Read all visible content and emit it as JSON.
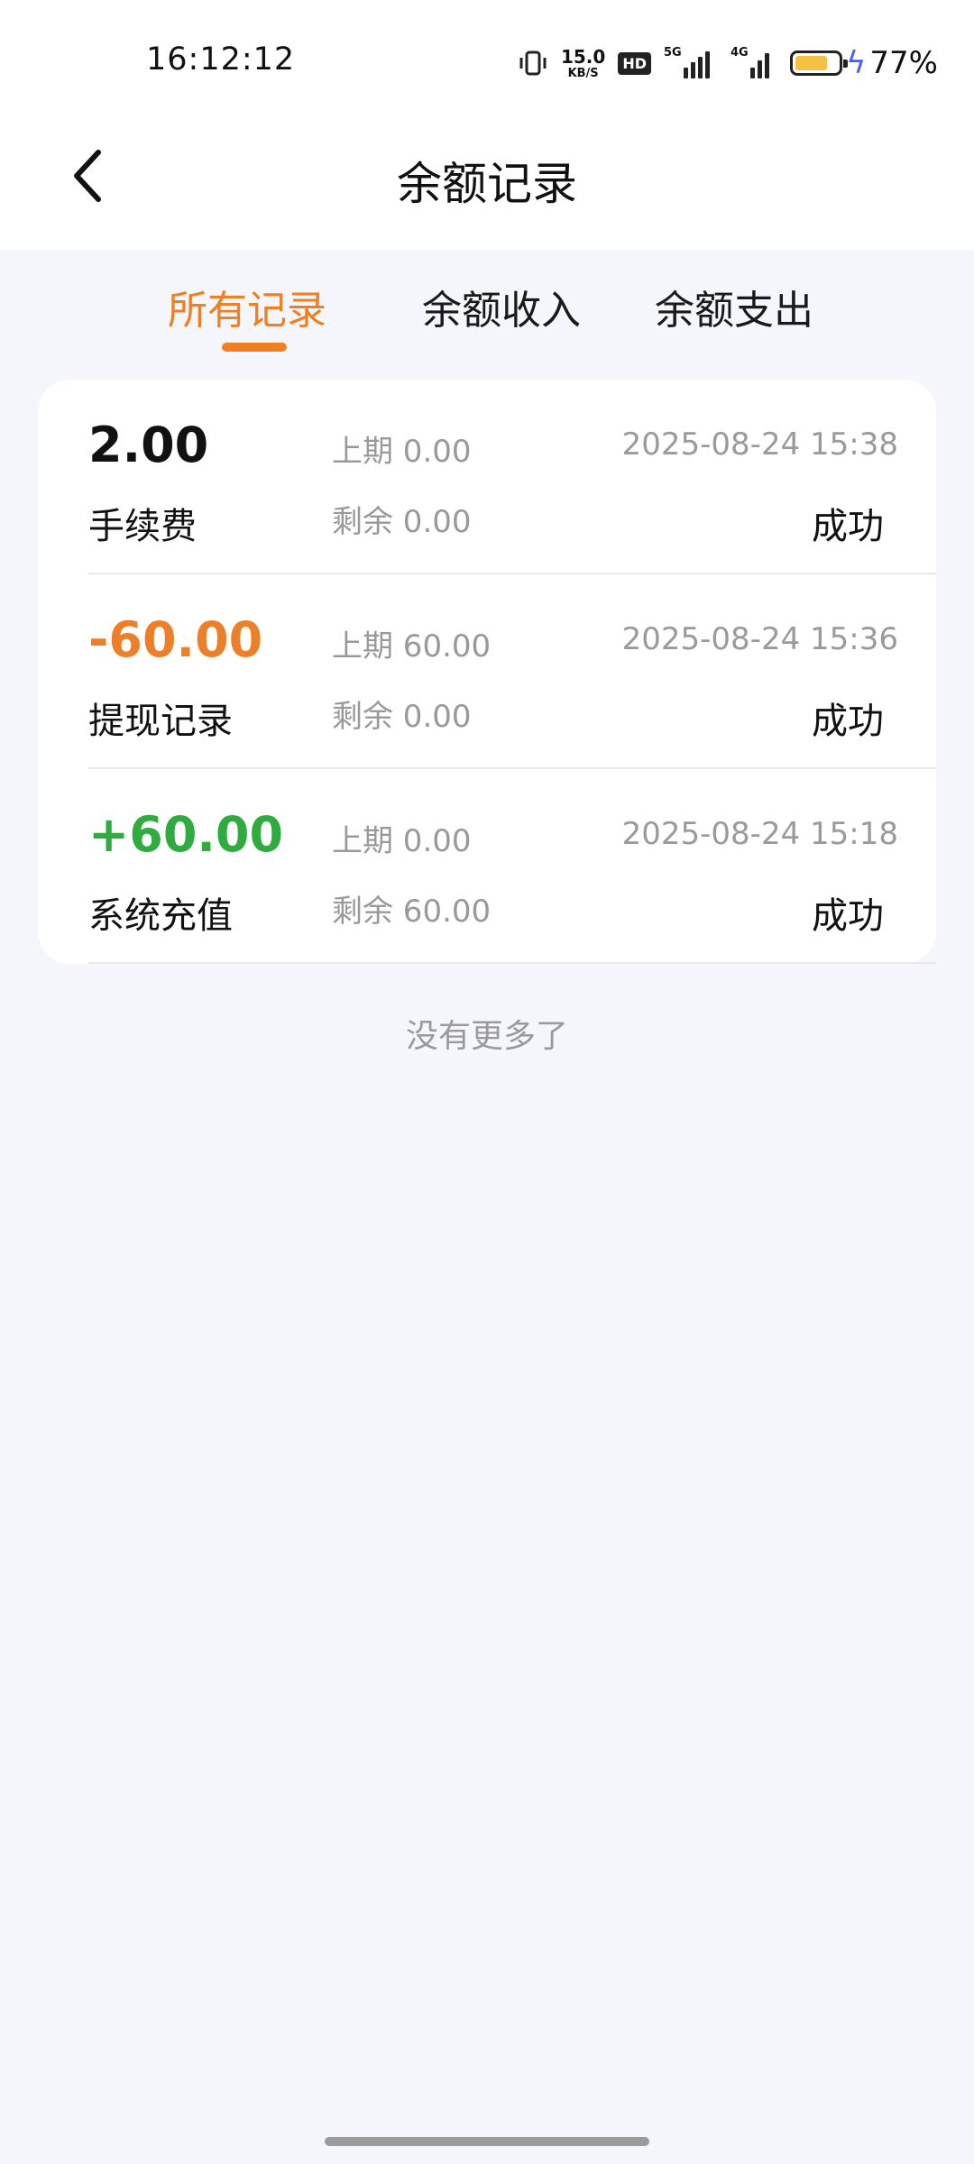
{
  "status_bar": {
    "time": "16:12:12",
    "net_speed_value": "15.0",
    "net_speed_unit": "KB/S",
    "hd_label": "HD",
    "signal_1_label": "5G",
    "signal_2_label": "4G",
    "battery_percent": "77%",
    "battery_level": 0.77,
    "battery_color": "#f5c142",
    "charging_color": "#4a5cf0"
  },
  "header": {
    "title": "余额记录",
    "back_icon": "chevron-left-icon"
  },
  "tabs": [
    {
      "label": "所有记录",
      "active": true
    },
    {
      "label": "余额收入",
      "active": false
    },
    {
      "label": "余额支出",
      "active": false
    }
  ],
  "records": [
    {
      "amount": "2.00",
      "type": "手续费",
      "prev": "上期 0.00",
      "remain": "剩余 0.00",
      "time": "2025-08-24 15:38",
      "status": "成功"
    },
    {
      "amount": "-60.00",
      "type": "提现记录",
      "prev": "上期 60.00",
      "remain": "剩余 0.00",
      "time": "2025-08-24 15:36",
      "status": "成功"
    },
    {
      "amount": "+60.00",
      "type": "系统充值",
      "prev": "上期 0.00",
      "remain": "剩余 60.00",
      "time": "2025-08-24 15:18",
      "status": "成功"
    }
  ],
  "footer_text": "没有更多了",
  "colors": {
    "accent": "#f07f22",
    "negative": "#ec7f29",
    "positive": "#2fab3f",
    "background": "#f5f6fb"
  }
}
